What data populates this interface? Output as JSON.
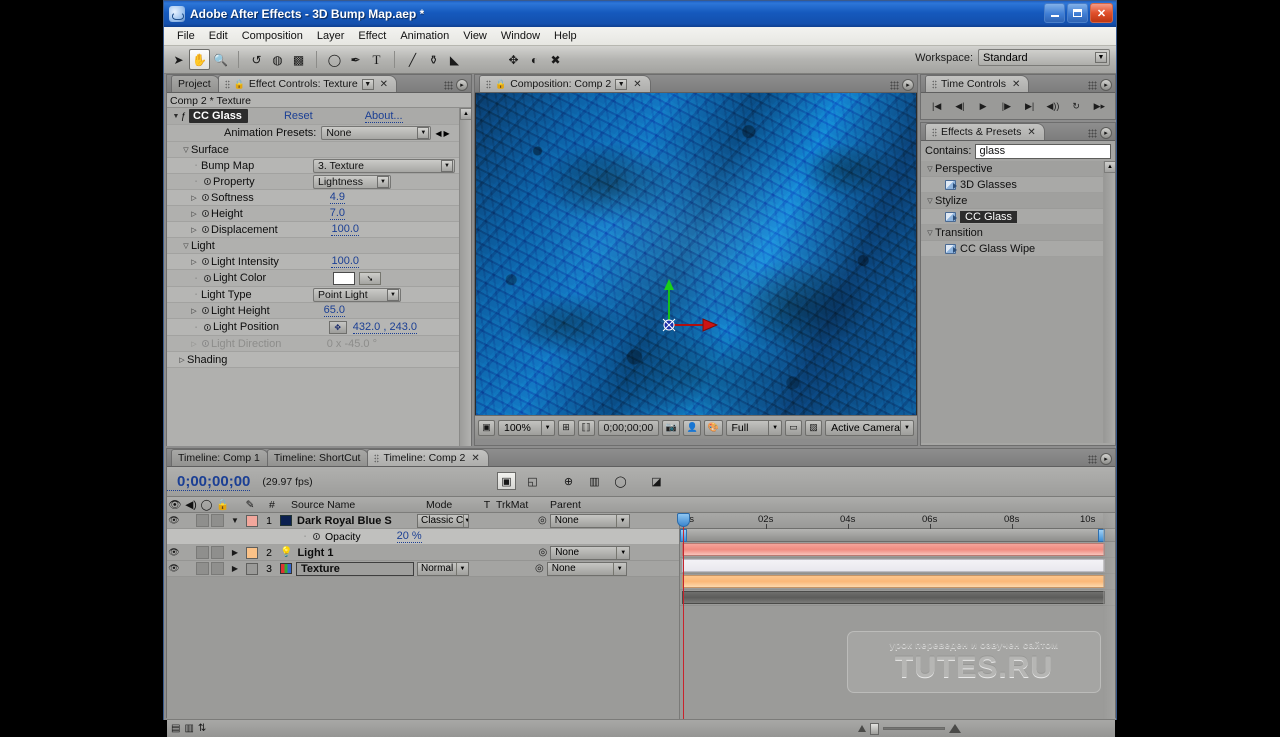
{
  "window": {
    "title": "Adobe After Effects - 3D Bump Map.aep *",
    "minimize": "–",
    "maximize": "□",
    "close": "✕"
  },
  "menubar": {
    "items": [
      "File",
      "Edit",
      "Composition",
      "Layer",
      "Effect",
      "Animation",
      "View",
      "Window",
      "Help"
    ]
  },
  "toolbar": {
    "tools": [
      {
        "name": "selection-tool",
        "glyph": "➤",
        "active": false
      },
      {
        "name": "hand-tool",
        "glyph": "✋",
        "active": true
      },
      {
        "name": "zoom-tool",
        "glyph": "🔍",
        "active": false
      },
      {
        "name": "rotation-tool",
        "glyph": "↺",
        "active": false
      },
      {
        "name": "camera-tool",
        "glyph": "◍",
        "active": false
      },
      {
        "name": "pan-behind-tool",
        "glyph": "▩",
        "active": false
      },
      {
        "name": "shape-tool",
        "glyph": "◯",
        "active": false
      },
      {
        "name": "pen-tool",
        "glyph": "✒",
        "active": false
      },
      {
        "name": "type-tool",
        "glyph": "T",
        "active": false
      },
      {
        "name": "brush-tool",
        "glyph": "🖌",
        "active": false
      },
      {
        "name": "clone-stamp-tool",
        "glyph": "⚱",
        "active": false
      },
      {
        "name": "eraser-tool",
        "glyph": "◢",
        "active": false
      },
      {
        "name": "puppet-pin-tool",
        "glyph": "✥",
        "active": false
      },
      {
        "name": "puppet-overlap-tool",
        "glyph": "◐",
        "active": false
      },
      {
        "name": "puppet-starch-tool",
        "glyph": "✖",
        "active": false
      }
    ],
    "workspace_label": "Workspace:",
    "workspace_value": "Standard"
  },
  "effect_controls": {
    "tabs": [
      {
        "label": "Project",
        "active": false
      },
      {
        "label": "Effect Controls: Texture",
        "active": true
      }
    ],
    "subtitle": "Comp 2 * Texture",
    "effect_name": "CC Glass",
    "reset_label": "Reset",
    "about_label": "About...",
    "animation_presets_label": "Animation Presets:",
    "animation_presets_value": "None",
    "groups": [
      {
        "name": "Surface",
        "params": [
          {
            "label": "Bump Map",
            "value": "3. Texture",
            "kind": "dropdown-wide"
          },
          {
            "label": "Property",
            "value": "Lightness",
            "kind": "dropdown"
          },
          {
            "label": "Softness",
            "value": "4.9",
            "kind": "number"
          },
          {
            "label": "Height",
            "value": "7.0",
            "kind": "number"
          },
          {
            "label": "Displacement",
            "value": "100.0",
            "kind": "number"
          }
        ]
      },
      {
        "name": "Light",
        "params": [
          {
            "label": "Light Intensity",
            "value": "100.0",
            "kind": "number"
          },
          {
            "label": "Light Color",
            "value": "",
            "kind": "color"
          },
          {
            "label": "Light Type",
            "value": "Point Light",
            "kind": "dropdown"
          },
          {
            "label": "Light Height",
            "value": "65.0",
            "kind": "number"
          },
          {
            "label": "Light Position",
            "value": "432.0 , 243.0",
            "kind": "position"
          },
          {
            "label": "Light Direction",
            "value": "0 x -45.0 °",
            "kind": "number-dim"
          }
        ]
      },
      {
        "name": "Shading",
        "params": []
      }
    ]
  },
  "composition": {
    "tab_label": "Composition: Comp 2",
    "footer": {
      "zoom": "100%",
      "timecode": "0;00;00;00",
      "resolution": "Full",
      "view": "Active Camera"
    }
  },
  "time_controls": {
    "tab_label": "Time Controls",
    "buttons": [
      {
        "name": "first-frame-button",
        "glyph": "|◀"
      },
      {
        "name": "previous-frame-button",
        "glyph": "◀|"
      },
      {
        "name": "play-button",
        "glyph": "▶"
      },
      {
        "name": "next-frame-button",
        "glyph": "|▶"
      },
      {
        "name": "last-frame-button",
        "glyph": "▶|"
      },
      {
        "name": "audio-toggle-button",
        "glyph": "◀))"
      },
      {
        "name": "loop-button",
        "glyph": "↻"
      },
      {
        "name": "ram-preview-button",
        "glyph": "▶▸"
      }
    ]
  },
  "effects_presets": {
    "tab_label": "Effects & Presets",
    "contains_label": "Contains:",
    "contains_value": "glass",
    "categories": [
      {
        "name": "Perspective",
        "items": [
          {
            "label": "3D Glasses",
            "selected": false
          }
        ]
      },
      {
        "name": "Stylize",
        "items": [
          {
            "label": "CC Glass",
            "selected": true
          }
        ]
      },
      {
        "name": "Transition",
        "items": [
          {
            "label": "CC Glass Wipe",
            "selected": false
          }
        ]
      }
    ]
  },
  "timeline": {
    "tabs": [
      {
        "label": "Timeline: Comp 1",
        "active": false
      },
      {
        "label": "Timeline: ShortCut",
        "active": false
      },
      {
        "label": "Timeline: Comp 2",
        "active": true
      }
    ],
    "current_time": "0;00;00;00",
    "fps": "(29.97 fps)",
    "columns": [
      "#",
      "Source Name",
      "Mode",
      "T",
      "TrkMat",
      "Parent"
    ],
    "rows": [
      {
        "kind": "layer",
        "index": "1",
        "name": "Dark Royal Blue S",
        "mode": "Classic C",
        "parent": "None",
        "color": "#f2a79c",
        "bar": "red",
        "expanded": true,
        "icon": "solid-swatch"
      },
      {
        "kind": "property",
        "index": "",
        "name": "Opacity",
        "value": "20 %",
        "bar": "white"
      },
      {
        "kind": "layer",
        "index": "2",
        "name": "Light 1",
        "mode": "",
        "parent": "None",
        "color": "#fbc288",
        "bar": "orange",
        "expanded": false,
        "icon": "light-bulb"
      },
      {
        "kind": "layer",
        "index": "3",
        "name": "Texture",
        "mode": "Normal",
        "parent": "None",
        "color": "#9a9a98",
        "bar": "gray",
        "expanded": false,
        "icon": "footage-thumb",
        "selected": true
      }
    ],
    "ruler_ticks": [
      "0s",
      "02s",
      "04s",
      "06s",
      "08s",
      "10s"
    ],
    "watermark_top": "урок переведен и озвучен сайтом",
    "watermark_main": "TUTES.RU"
  }
}
